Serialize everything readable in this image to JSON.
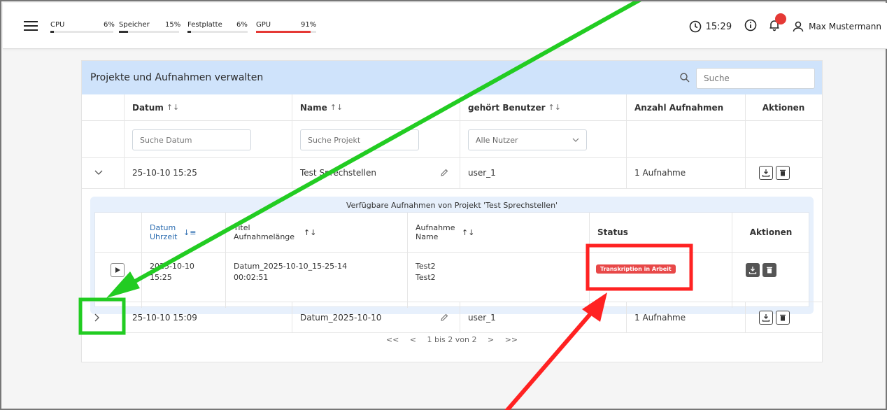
{
  "topbar": {
    "metrics": [
      {
        "label": "CPU",
        "value": "6%",
        "percent": 6
      },
      {
        "label": "Speicher",
        "value": "15%",
        "percent": 15
      },
      {
        "label": "Festplatte",
        "value": "6%",
        "percent": 6
      },
      {
        "label": "GPU",
        "value": "91%",
        "percent": 91
      }
    ],
    "time": "15:29",
    "user_name": "Max Mustermann",
    "notification_color": "#e53935"
  },
  "card": {
    "title": "Projekte und Aufnahmen verwalten",
    "search_placeholder": "Suche",
    "columns": {
      "datum": "Datum",
      "name": "Name",
      "user": "gehört Benutzer",
      "count": "Anzahl Aufnahmen",
      "actions": "Aktionen"
    },
    "sort_glyph": "↑↓",
    "filters": {
      "datum_placeholder": "Suche Datum",
      "projekt_placeholder": "Suche Projekt",
      "user_select": "Alle Nutzer"
    },
    "rows": [
      {
        "date": "25-10-10 15:25",
        "name": "Test Sprechstellen",
        "user": "user_1",
        "count": "1 Aufnahme"
      },
      {
        "date": "25-10-10 15:09",
        "name": "Datum_2025-10-10",
        "user": "user_1",
        "count": "1 Aufnahme"
      }
    ]
  },
  "nested": {
    "title": "Verfügbare Aufnahmen von Projekt 'Test Sprechstellen'",
    "columns": {
      "datum_l1": "Datum",
      "datum_l2": "Uhrzeit",
      "titel_l1": "Titel",
      "titel_l2": "Aufnahmelänge",
      "aufn_l1": "Aufnahme",
      "aufn_l2": "Name",
      "status": "Status",
      "actions": "Aktionen"
    },
    "sort_glyph": "↑↓",
    "sort_active_glyph": "↓≡",
    "row": {
      "date": "2025-10-10",
      "time": "15:25",
      "title": "Datum_2025-10-10_15-25-14",
      "length": "00:02:51",
      "aufn_name": "Test2",
      "aufn_name2": "Test2",
      "status": "Transkription in Arbeit"
    }
  },
  "pager": {
    "first": "<<",
    "prev": "<",
    "info": "1 bis 2 von 2",
    "next": ">",
    "last": ">>"
  },
  "colors": {
    "header_bg": "#cfe3fb",
    "badge": "#e84848",
    "annotation_green": "#22cc22",
    "annotation_red": "#ff2222"
  }
}
